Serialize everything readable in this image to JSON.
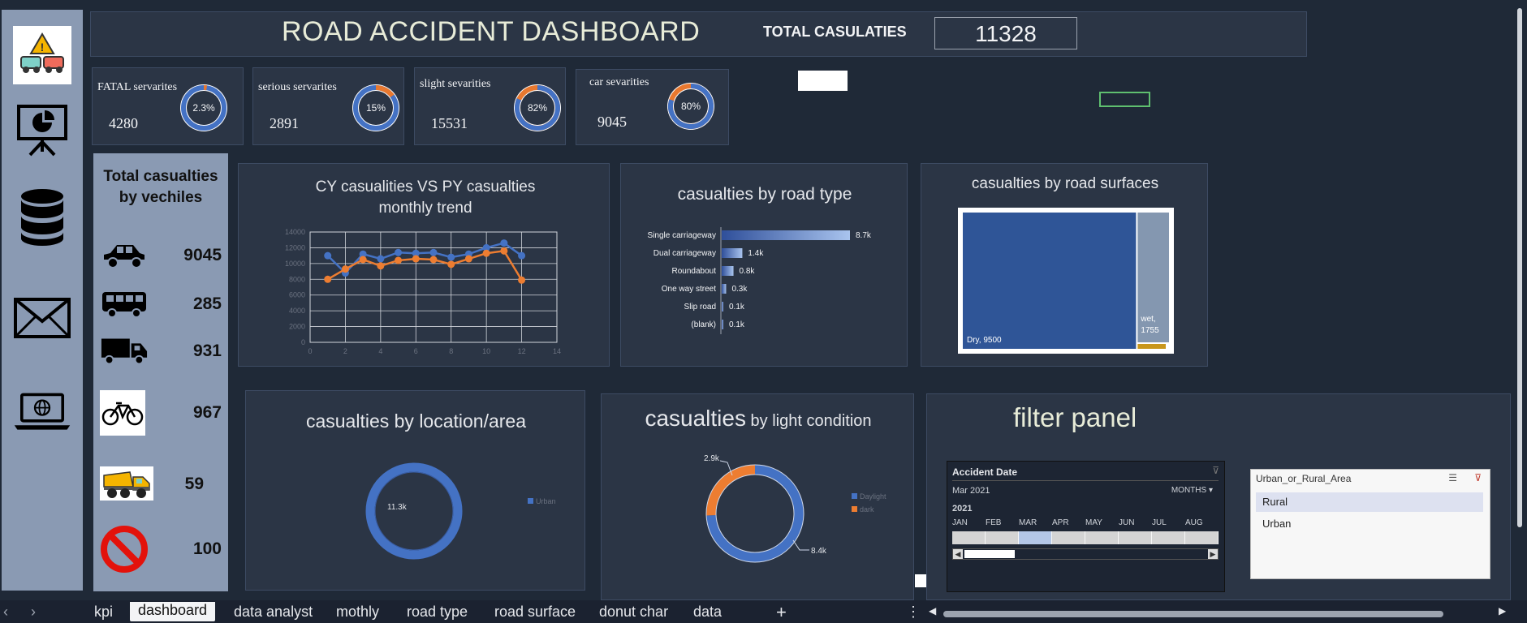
{
  "header": {
    "title": "ROAD ACCIDENT DASHBOARD",
    "total_label": "TOTAL CASULATIES",
    "total_value": "11328"
  },
  "sidebar": {
    "icons": [
      "warning-crash-icon",
      "presentation-chart-icon",
      "database-icon",
      "mail-icon",
      "laptop-globe-icon"
    ]
  },
  "kpis": [
    {
      "label": "FATAL servarites",
      "value": "4280",
      "pct_text": "2.3%",
      "pct": 0.023,
      "color": "#e8782f"
    },
    {
      "label": "serious servarites",
      "value": "2891",
      "pct_text": "15%",
      "pct": 0.15,
      "color": "#e8782f"
    },
    {
      "label": "slight sevarities",
      "value": "15531",
      "pct_text": "82%",
      "pct": 0.82,
      "color": "#4472c4"
    },
    {
      "label": "car sevarities",
      "value": "9045",
      "pct_text": "80%",
      "pct": 0.8,
      "color": "#4472c4"
    }
  ],
  "vehicles": {
    "title": "Total casualties  by vechiles",
    "items": [
      {
        "icon": "car-icon",
        "value": "9045"
      },
      {
        "icon": "bus-icon",
        "value": "285"
      },
      {
        "icon": "truck-icon",
        "value": "931"
      },
      {
        "icon": "bicycle-icon",
        "value": "967"
      },
      {
        "icon": "dump-truck-icon",
        "value": "59"
      },
      {
        "icon": "prohibited-icon",
        "value": "100"
      }
    ]
  },
  "charts": {
    "trend": {
      "title": "CY casualities VS PY casualties monthly trend"
    },
    "road_type": {
      "title": "casualties by road type"
    },
    "surface": {
      "title": "casualties by road surfaces"
    },
    "location": {
      "title": "casualties by location/area"
    },
    "light": {
      "title_big": "casualties",
      "title_small": " by light condition"
    }
  },
  "chart_data": [
    {
      "type": "line",
      "title": "CY casualities VS PY casualties monthly trend",
      "x": [
        1,
        2,
        3,
        4,
        5,
        6,
        7,
        8,
        9,
        10,
        11,
        12
      ],
      "series": [
        {
          "values": [
            11000,
            8800,
            11200,
            10600,
            11400,
            11300,
            11400,
            10800,
            11200,
            12000,
            12600,
            11000
          ],
          "color": "#4472c4"
        },
        {
          "values": [
            8000,
            9300,
            10500,
            9700,
            10400,
            10600,
            10500,
            9900,
            10600,
            11300,
            11600,
            7900
          ],
          "color": "#ed7d31"
        }
      ],
      "xlim": [
        0,
        14
      ],
      "ylim": [
        0,
        14000
      ],
      "xticks": [
        0,
        2,
        4,
        6,
        8,
        10,
        12,
        14
      ],
      "yticks": [
        0,
        2000,
        4000,
        6000,
        8000,
        10000,
        12000,
        14000
      ],
      "grid": true
    },
    {
      "type": "bar",
      "title": "casualties by road type",
      "categories": [
        "Single carriageway",
        "Dual carriageway",
        "Roundabout",
        "One way street",
        "Slip road",
        "(blank)"
      ],
      "values": [
        8700,
        1400,
        800,
        300,
        100,
        100
      ],
      "labels": [
        "8.7k",
        "1.4k",
        "0.8k",
        "0.3k",
        "0.1k",
        "0.1k"
      ]
    },
    {
      "type": "treemap",
      "title": "casualties by road surfaces",
      "categories": [
        "Dry",
        "wet"
      ],
      "values": [
        9500,
        1755
      ],
      "labels": [
        "Dry, 9500",
        "wet, 1755"
      ],
      "colors": [
        "#2f5597",
        "#8497b0"
      ]
    },
    {
      "type": "pie",
      "title": "casualties by location/area",
      "categories": [
        "Urban"
      ],
      "values": [
        11300
      ],
      "labels": [
        "11.3k"
      ],
      "legend": [
        "Urban"
      ],
      "legend_position": "right"
    },
    {
      "type": "pie",
      "title": "casualties by light condition",
      "categories": [
        "Daylight",
        "dark"
      ],
      "values": [
        8400,
        2900
      ],
      "labels": [
        "8.4k",
        "2.9k"
      ],
      "colors": [
        "#4472c4",
        "#ed7d31"
      ],
      "legend_position": "right"
    }
  ],
  "filter_panel": {
    "title": "filter panel",
    "date_slicer": {
      "header": "Accident Date",
      "range": "Mar 2021",
      "unit": "MONTHS",
      "year": "2021",
      "months": [
        "JAN",
        "FEB",
        "MAR",
        "APR",
        "MAY",
        "JUN",
        "JUL",
        "AUG"
      ],
      "selected": "MAR"
    },
    "area_slicer": {
      "header": "Urban_or_Rural_Area",
      "items": [
        "Rural",
        "Urban"
      ],
      "selected": "Rural"
    }
  },
  "sheet_tabs": [
    "kpi",
    "dashboard",
    "data analyst",
    "mothly",
    "road type",
    "road surface",
    "donut char",
    "data"
  ],
  "active_tab": "dashboard"
}
